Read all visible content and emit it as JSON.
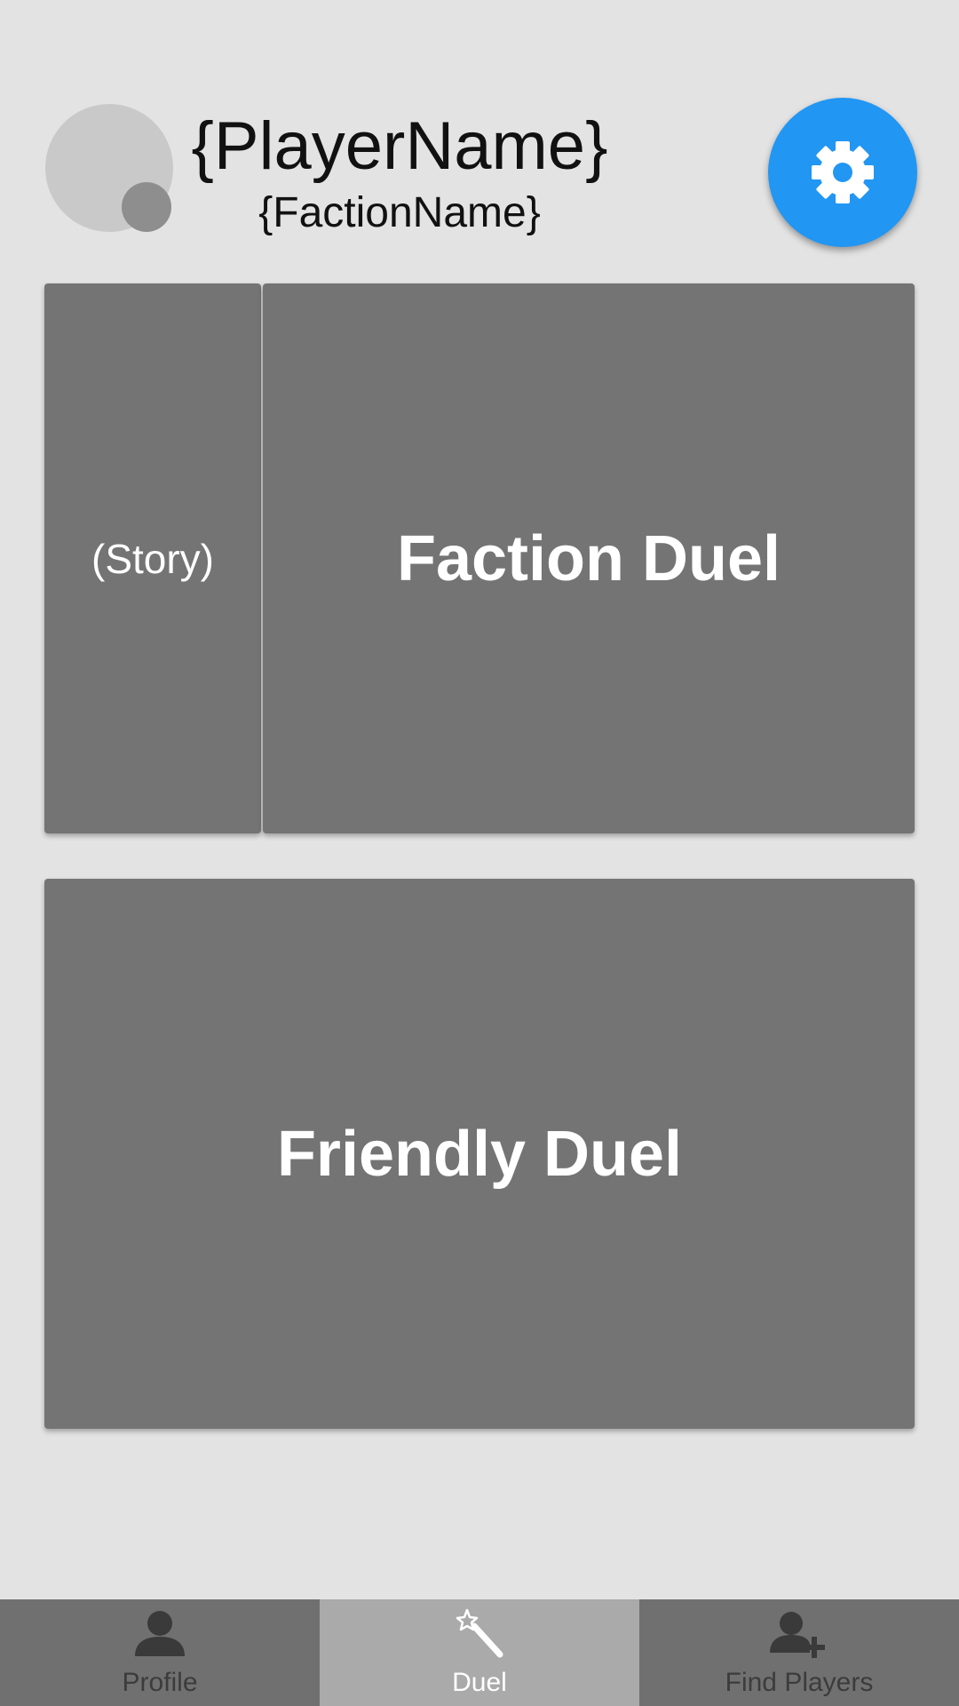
{
  "header": {
    "player_name": "{PlayerName}",
    "faction_name": "{FactionName}",
    "settings_icon": "gear-icon"
  },
  "cards": {
    "story_label": "(Story)",
    "faction_duel_label": "Faction Duel",
    "friendly_duel_label": "Friendly Duel"
  },
  "tabs": [
    {
      "label": "Profile",
      "icon": "person-icon",
      "active": false
    },
    {
      "label": "Duel",
      "icon": "magic-wand-icon",
      "active": true
    },
    {
      "label": "Find Players",
      "icon": "add-person-icon",
      "active": false
    }
  ],
  "colors": {
    "accent": "#2196f3",
    "card": "#747474",
    "tab_inactive": "#707070",
    "tab_active": "#aaaaaa",
    "background": "#e3e3e3"
  }
}
